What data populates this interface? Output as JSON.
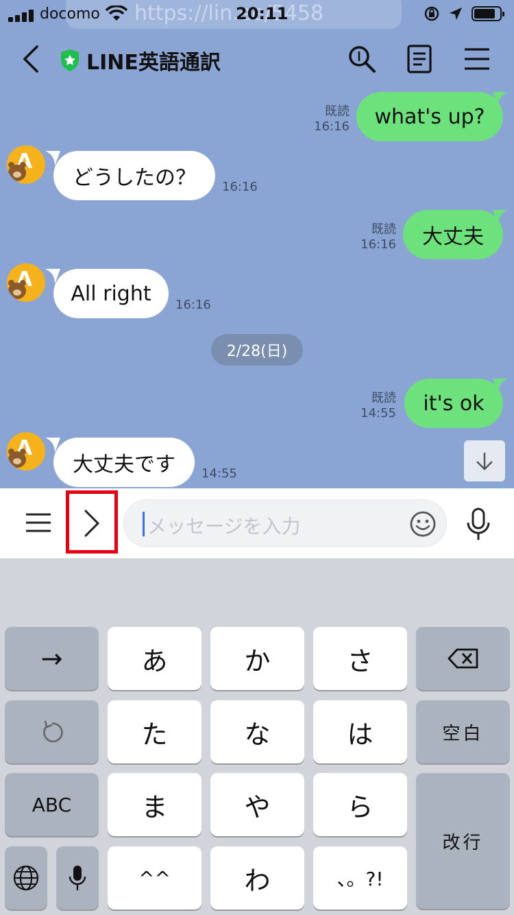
{
  "status_bar": {
    "carrier": "docomo",
    "time": "20:11",
    "url_ghost": "https://lin.ee/5458"
  },
  "header": {
    "title": "LINE英語通訳",
    "icons": [
      "back-chevron-icon",
      "shield-star-icon",
      "search-icon",
      "notes-icon",
      "menu-icon"
    ]
  },
  "messages": [
    {
      "from": "me",
      "text": "what's up?",
      "read": "既読",
      "time": "16:16"
    },
    {
      "from": "bot",
      "text": "どうしたの？",
      "time": "16:16"
    },
    {
      "from": "me",
      "text": "大丈夫",
      "read": "既読",
      "time": "16:16"
    },
    {
      "from": "bot",
      "text": "All right",
      "time": "16:16"
    },
    {
      "from": "me",
      "text": "it's ok",
      "read": "既読",
      "time": "14:55"
    },
    {
      "from": "bot",
      "text": "大丈夫です",
      "time": "14:55"
    }
  ],
  "date_separator": "2/28(日)",
  "input": {
    "placeholder": "メッセージを入力",
    "icons": [
      "menu-icon",
      "chevron-right-icon",
      "emoji-icon",
      "microphone-icon"
    ]
  },
  "keyboard": {
    "row1": [
      "→",
      "あ",
      "か",
      "さ",
      "⌫"
    ],
    "row2": [
      "↺",
      "た",
      "な",
      "は",
      "空白"
    ],
    "row3": [
      "ABC",
      "ま",
      "や",
      "ら",
      "改行"
    ],
    "row4": [
      "🌐",
      "🎤",
      "^^",
      "わ",
      "、。?!"
    ]
  },
  "colors": {
    "chat_bg": "#8aa5d4",
    "my_bubble": "#6ce17c",
    "their_bubble": "#ffffff",
    "highlight": "#e60012"
  }
}
